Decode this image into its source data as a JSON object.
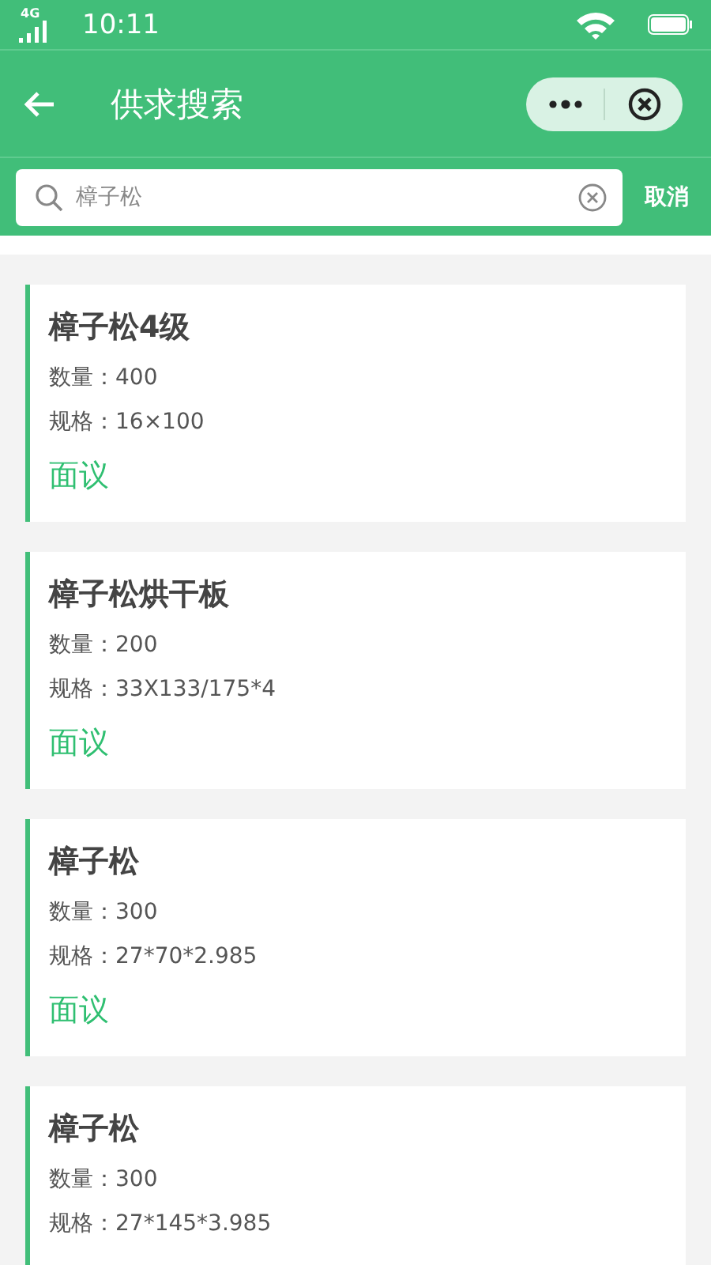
{
  "status_bar": {
    "network": "4G",
    "time": "10:11"
  },
  "header": {
    "title": "供求搜索"
  },
  "search": {
    "value": "樟子松",
    "cancel": "取消"
  },
  "results": [
    {
      "title": "樟子松4级",
      "quantity": "数量：400",
      "spec": "规格：16×100",
      "price": "面议"
    },
    {
      "title": "樟子松烘干板",
      "quantity": "数量：200",
      "spec": "规格：33X133/175*4",
      "price": "面议"
    },
    {
      "title": "樟子松",
      "quantity": "数量：300",
      "spec": "规格：27*70*2.985",
      "price": "面议"
    },
    {
      "title": "樟子松",
      "quantity": "数量：300",
      "spec": "规格：27*145*3.985"
    }
  ]
}
